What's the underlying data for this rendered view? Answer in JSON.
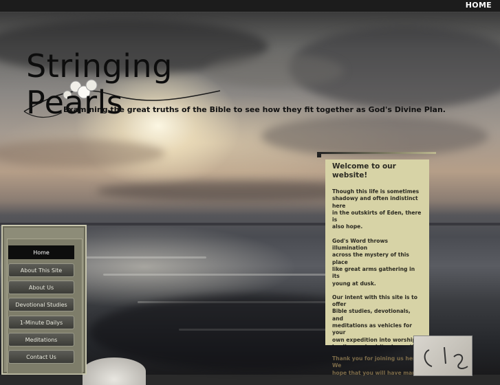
{
  "topbar": {
    "home_label": "HOME"
  },
  "header": {
    "title_line1": "Stringing",
    "title_line2": "Pearls",
    "tagline": "Examining the great truths of the Bible to see how they fit together as God's Divine Plan."
  },
  "nav": {
    "items": [
      {
        "label": "Home",
        "active": true
      },
      {
        "label": "About This Site",
        "active": false
      },
      {
        "label": "About Us",
        "active": false
      },
      {
        "label": "Devotional Studies",
        "active": false
      },
      {
        "label": "1-Minute Dailys",
        "active": false
      },
      {
        "label": "Meditations",
        "active": false
      },
      {
        "label": "Contact Us",
        "active": false
      }
    ]
  },
  "welcome": {
    "heading": "Welcome to our website!",
    "para1": "Though this life is sometimes\nshadowy and often indistinct\nhere\nin the outskirts of Eden, there\nis\nalso hope.",
    "para2": "God's Word throws\nillumination\nacross the mystery of this\nplace\nlike great arms gathering in\nits\nyoung at dusk.",
    "para3": "Our intent with this site is to\noffer\nBible studies, devotionals,\nand\nmeditations as vehicles for\nyour\nown expedition into worship,\nhealing and spiritual growth.",
    "overflow": "Thank you for joining us here.\nWe\nhope that you will have many"
  },
  "colors": {
    "topbar_bg": "#1c1c1c",
    "panel_bg": "#d7d3a6",
    "nav_frame": "#8d8c78",
    "nav_active": "#0d0d0d"
  }
}
